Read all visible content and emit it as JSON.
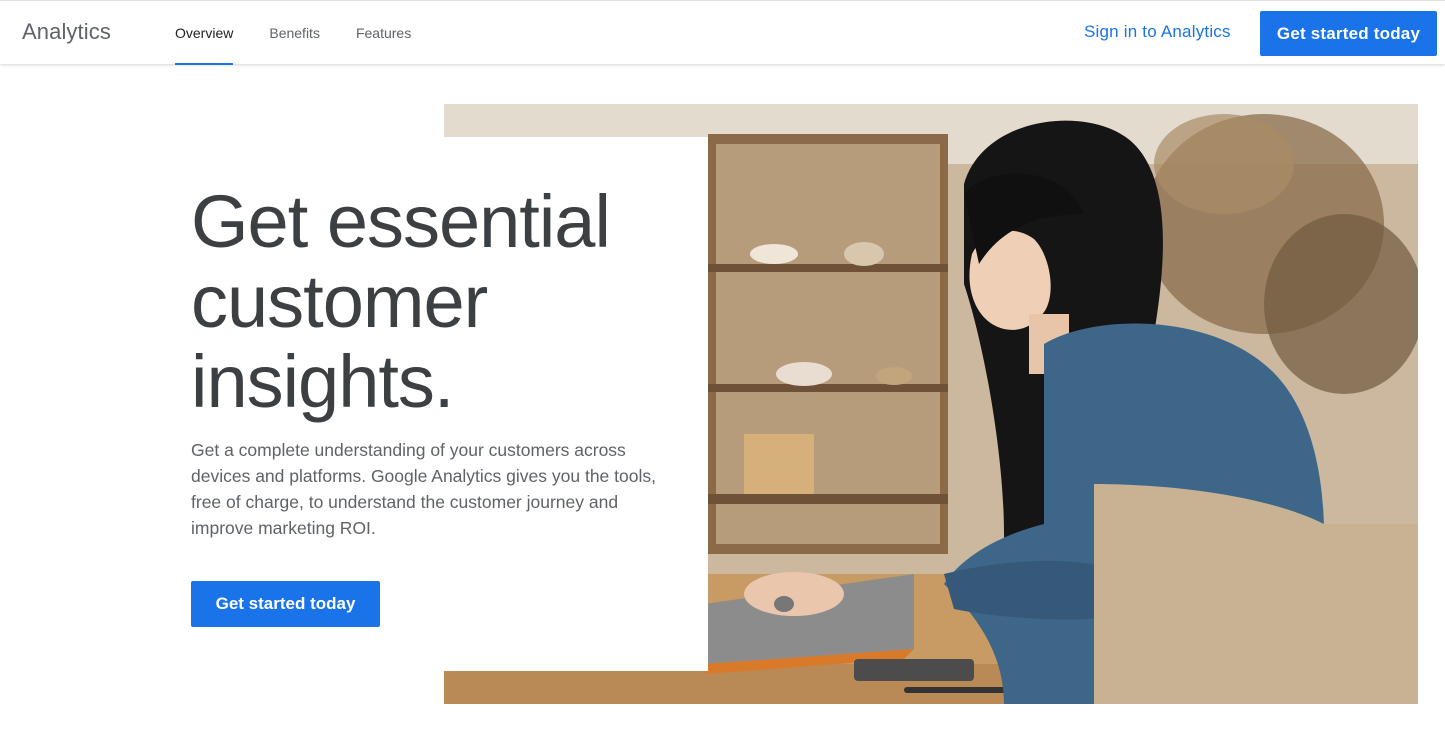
{
  "header": {
    "brand": "Analytics",
    "tabs": [
      {
        "label": "Overview",
        "active": true
      },
      {
        "label": "Benefits",
        "active": false
      },
      {
        "label": "Features",
        "active": false
      }
    ],
    "signin_label": "Sign in to Analytics",
    "cta_label": "Get started today"
  },
  "hero": {
    "headline": "Get essential customer insights.",
    "description": "Get a complete understanding of your customers across devices and platforms. Google Analytics gives you the tools, free of charge, to understand the customer journey and improve marketing ROI.",
    "cta_label": "Get started today",
    "image": "woman-typing-on-laptop-photo"
  },
  "colors": {
    "accent": "#1a73e8",
    "text_primary": "#3c4043",
    "text_secondary": "#5f6368"
  }
}
